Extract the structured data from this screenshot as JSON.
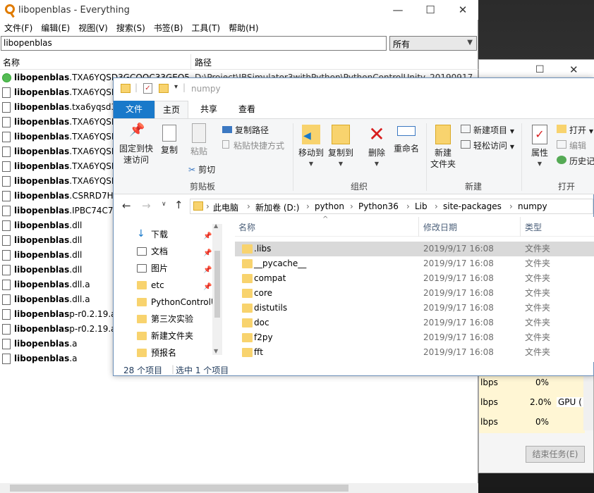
{
  "everything": {
    "title": "libopenblas - Everything",
    "controls": {
      "minimize": "—",
      "maximize": "☐",
      "close": "✕"
    },
    "menu": [
      "文件(F)",
      "编辑(E)",
      "视图(V)",
      "搜索(S)",
      "书签(B)",
      "工具(T)",
      "帮助(H)"
    ],
    "search_value": "libopenblas",
    "filter": "所有",
    "columns": {
      "name": "名称",
      "path": "路径"
    },
    "rows": [
      {
        "bold": "libopenblas",
        "rest": ".TXA6YQSD3GCQOC33GEO5...",
        "path": "D:\\Project\\IBSimulator3withPython\\PythonControlUnity_20190917",
        "green": true
      },
      {
        "bold": "libopenblas",
        "rest": ".TXA6YQSD3",
        "path": "",
        "green": false
      },
      {
        "bold": "libopenblas",
        "rest": ".txa6yqsd3g",
        "path": "",
        "green": false
      },
      {
        "bold": "libopenblas",
        "rest": ".TXA6YQSD3",
        "path": "",
        "green": false
      },
      {
        "bold": "libopenblas",
        "rest": ".TXA6YQSD3",
        "path": "",
        "green": false
      },
      {
        "bold": "libopenblas",
        "rest": ".TXA6YQSD3",
        "path": "",
        "green": false
      },
      {
        "bold": "libopenblas",
        "rest": ".TXA6YQSD3",
        "path": "",
        "green": false
      },
      {
        "bold": "libopenblas",
        "rest": ".TXA6YQSD3",
        "path": "",
        "green": false
      },
      {
        "bold": "libopenblas",
        "rest": ".CSRRD7HK",
        "path": "",
        "green": false
      },
      {
        "bold": "libopenblas",
        "rest": ".IPBC74C7K",
        "path": "",
        "green": false
      },
      {
        "bold": "libopenblas",
        "rest": ".dll",
        "path": "",
        "green": false
      },
      {
        "bold": "libopenblas",
        "rest": ".dll",
        "path": "",
        "green": false
      },
      {
        "bold": "libopenblas",
        "rest": ".dll",
        "path": "",
        "green": false
      },
      {
        "bold": "libopenblas",
        "rest": ".dll",
        "path": "",
        "green": false
      },
      {
        "bold": "libopenblas",
        "rest": ".dll.a",
        "path": "",
        "green": false
      },
      {
        "bold": "libopenblas",
        "rest": ".dll.a",
        "path": "",
        "green": false
      },
      {
        "bold": "libopenblas",
        "rest": "p-r0.2.19.a",
        "path": "",
        "green": false
      },
      {
        "bold": "libopenblas",
        "rest": "p-r0.2.19.a",
        "path": "",
        "green": false
      },
      {
        "bold": "libopenblas",
        "rest": ".a",
        "path": "",
        "green": false
      },
      {
        "bold": "libopenblas",
        "rest": ".a",
        "path": "",
        "green": false
      }
    ]
  },
  "taskmgr": {
    "rows": [
      {
        "net": "lbps",
        "gpu": "0%"
      },
      {
        "net": "lbps",
        "gpu": "2.0%",
        "engine": "GPU ("
      },
      {
        "net": "lbps",
        "gpu": "0%"
      }
    ],
    "end_task": "结束任务(E)"
  },
  "explorer": {
    "title": "numpy",
    "tabs": {
      "file": "文件",
      "home": "主页",
      "share": "共享",
      "view": "查看"
    },
    "ribbon": {
      "pin": "固定到快\n速访问",
      "copy": "复制",
      "paste": "粘贴",
      "copy_path": "复制路径",
      "paste_shortcut": "粘贴快捷方式",
      "cut": "剪切",
      "clipboard_group": "剪贴板",
      "move_to": "移动到",
      "copy_to": "复制到",
      "delete": "删除",
      "rename": "重命名",
      "organize_group": "组织",
      "new_folder": "新建\n文件夹",
      "new_item": "新建项目",
      "easy_access": "轻松访问",
      "new_group": "新建",
      "properties": "属性",
      "open": "打开",
      "edit": "编辑",
      "history": "历史记",
      "open_group": "打开"
    },
    "breadcrumb": [
      "此电脑",
      "新加卷 (D:)",
      "python",
      "Python36",
      "Lib",
      "site-packages",
      "numpy"
    ],
    "nav": [
      {
        "label": "下载",
        "pin": true
      },
      {
        "label": "文档",
        "pin": true
      },
      {
        "label": "图片",
        "pin": true
      },
      {
        "label": "etc",
        "pin": true
      },
      {
        "label": "PythonControlU",
        "pin": false
      },
      {
        "label": "第三次实验",
        "pin": false
      },
      {
        "label": "新建文件夹",
        "pin": false
      },
      {
        "label": "预报名",
        "pin": false
      }
    ],
    "columns": {
      "name": "名称",
      "date": "修改日期",
      "type": "类型"
    },
    "files": [
      {
        "name": ".libs",
        "date": "2019/9/17 16:08",
        "type": "文件夹",
        "selected": true
      },
      {
        "name": "__pycache__",
        "date": "2019/9/17 16:08",
        "type": "文件夹"
      },
      {
        "name": "compat",
        "date": "2019/9/17 16:08",
        "type": "文件夹"
      },
      {
        "name": "core",
        "date": "2019/9/17 16:08",
        "type": "文件夹"
      },
      {
        "name": "distutils",
        "date": "2019/9/17 16:08",
        "type": "文件夹"
      },
      {
        "name": "doc",
        "date": "2019/9/17 16:08",
        "type": "文件夹"
      },
      {
        "name": "f2py",
        "date": "2019/9/17 16:08",
        "type": "文件夹"
      },
      {
        "name": "fft",
        "date": "2019/9/17 16:08",
        "type": "文件夹"
      }
    ],
    "status": {
      "count": "28 个项目",
      "selected": "选中 1 个项目"
    }
  }
}
